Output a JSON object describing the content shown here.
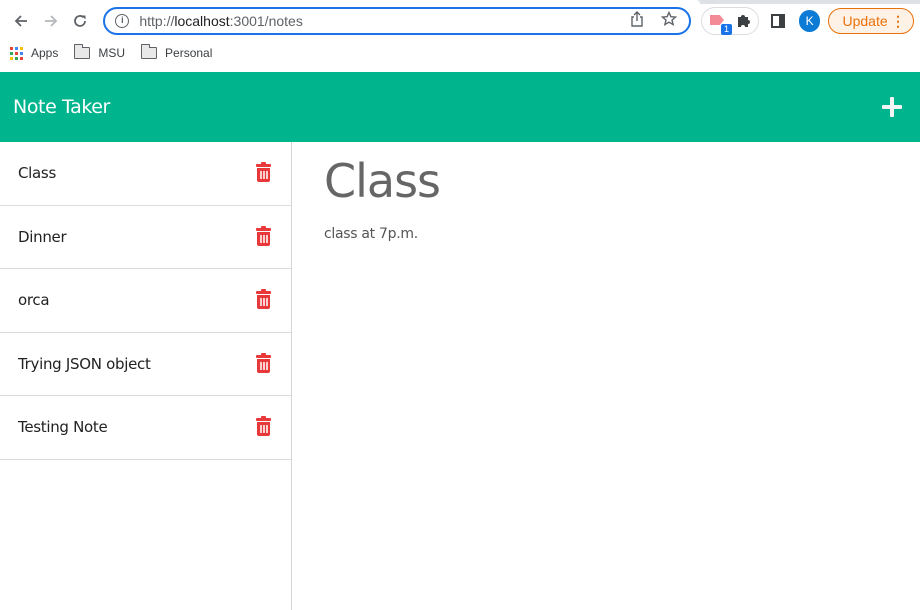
{
  "browser": {
    "url_prefix": "http://",
    "url_host": "localhost",
    "url_rest": ":3001/notes",
    "info_icon": "i",
    "extension_badge": "1",
    "avatar_letter": "K",
    "update_label": "Update",
    "bookmarks": [
      {
        "label": "Apps",
        "icon": "apps-grid-icon"
      },
      {
        "label": "MSU",
        "icon": "folder-icon"
      },
      {
        "label": "Personal",
        "icon": "folder-icon"
      }
    ]
  },
  "app": {
    "title": "Note Taker",
    "accent_color": "#00b58e",
    "delete_color": "#e8383a"
  },
  "notes": [
    {
      "title": "Class"
    },
    {
      "title": "Dinner"
    },
    {
      "title": "orca"
    },
    {
      "title": "Trying JSON object"
    },
    {
      "title": "Testing Note"
    }
  ],
  "active_note": {
    "title": "Class",
    "text": "class at 7p.m."
  }
}
